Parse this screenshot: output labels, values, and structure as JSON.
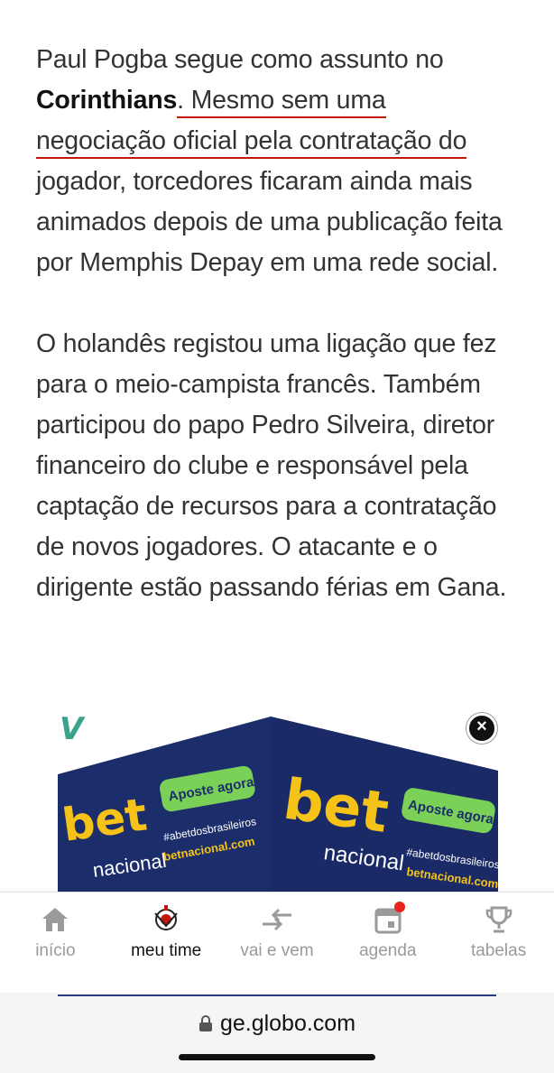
{
  "article": {
    "p1_before": "Paul Pogba segue como assunto no ",
    "p1_bold": "Corinthians",
    "p1_link_a": ". Mesmo sem uma",
    "p1_link_b": "negociação oficial pela contratação do",
    "p1_after": " jogador, torcedores ficaram ainda mais animados depois de uma publicação feita por Memphis Depay em uma rede social.",
    "p2": "O holandês registou uma ligação que fez para o meio-campista francês. Também participou do papo Pedro Silveira, diretor financeiro do clube e responsável pela captação de recursos para a contratação de novos jogadores. O atacante e o dirigente estão passando férias em Gana."
  },
  "ad": {
    "logo_letter": "V",
    "brand_top": "bet",
    "brand_bottom": "nacional",
    "cta": "Aposte agora!",
    "hashtag": "#abetdosbrasileiros",
    "site": "betnacional.com",
    "close_symbol": "×",
    "colors": {
      "banner": "#1c2d6b",
      "accent": "#f5c318",
      "cta_bg": "#7bd158"
    }
  },
  "tabbar": {
    "items": [
      {
        "label": "início",
        "icon": "home-icon",
        "active": false
      },
      {
        "label": "meu time",
        "icon": "corinthians-crest-icon",
        "active": true
      },
      {
        "label": "vai e vem",
        "icon": "transfer-arrows-icon",
        "active": false
      },
      {
        "label": "agenda",
        "icon": "calendar-icon",
        "active": false,
        "badge": true
      },
      {
        "label": "tabelas",
        "icon": "trophy-icon",
        "active": false
      }
    ]
  },
  "browser": {
    "url": "ge.globo.com"
  }
}
